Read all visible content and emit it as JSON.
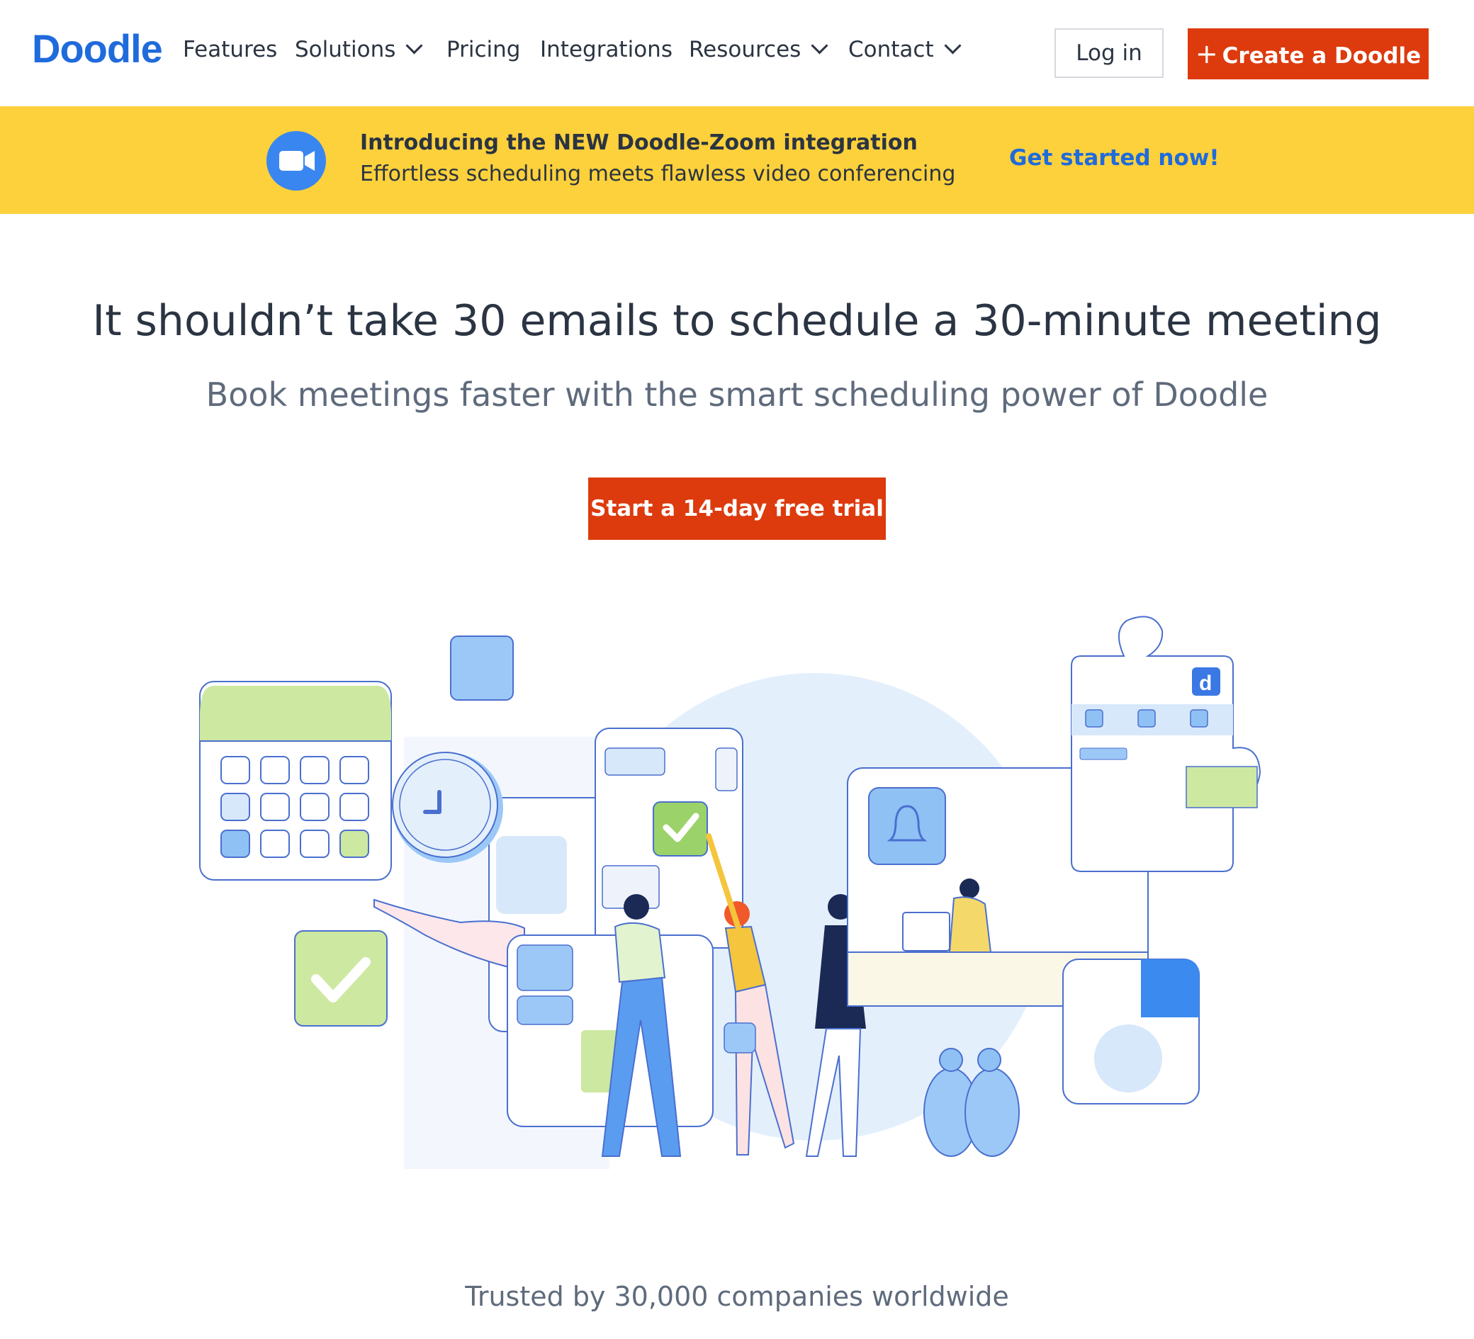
{
  "nav": {
    "logo": "Doodle",
    "items": [
      {
        "label": "Features"
      },
      {
        "label": "Solutions"
      },
      {
        "label": "Pricing"
      },
      {
        "label": "Integrations"
      },
      {
        "label": "Resources"
      },
      {
        "label": "Contact"
      }
    ],
    "login_label": "Log in",
    "create_label": "Create a Doodle"
  },
  "banner": {
    "title": "Introducing the NEW Doodle-Zoom integration",
    "subtitle": "Effortless scheduling meets flawless video conferencing",
    "cta": "Get started now!"
  },
  "hero": {
    "headline": "It shouldn’t take 30 emails to schedule a 30-minute meeting",
    "subheadline": "Book meetings faster with the smart scheduling power of Doodle",
    "cta": "Start a 14-day free trial"
  },
  "trusted": "Trusted by 30,000 companies worldwide",
  "colors": {
    "brand_blue": "#1f6bdc",
    "cta_red": "#dd3a0d",
    "banner_yellow": "#fdd13b",
    "text_dark": "#2b3442",
    "text_gray": "#5f6b7c"
  },
  "icons": {
    "video_camera": "video-camera-icon",
    "plus": "plus-icon",
    "chevron": "chevron-down-icon"
  }
}
